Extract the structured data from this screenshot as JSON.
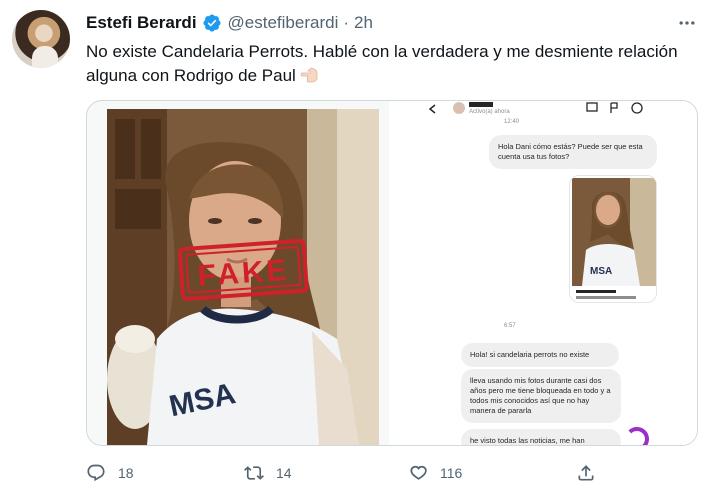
{
  "author": {
    "display_name": "Estefi Berardi",
    "handle": "@estefiberardi",
    "separator": "·",
    "timestamp": "2h",
    "verified": true
  },
  "tweet": {
    "text": "No existe Candelaria Perrots. Hablé con la verdadera y me desmiente relación alguna con Rodrigo de Paul",
    "emoji": "pointing-left-hand"
  },
  "media": {
    "left_image_stamp": "FAKE",
    "dm_screenshot": {
      "status": "Activo(a) ahora",
      "time_top": "12:40",
      "time_mid": "6:57",
      "messages": [
        "Hola Dani cómo estás? Puede ser que esta cuenta usa tus fotos?",
        "Hola! si candelaria perrots no existe",
        "lleva usando mis fotos durante casi dos años pero me tiene bloqueada en todo y a todos mis conocidos así que no hay manera de pararla",
        "he visto todas las noticias, me han"
      ]
    }
  },
  "actions": {
    "reply_count": "18",
    "retweet_count": "14",
    "like_count": "116"
  },
  "colors": {
    "text": "#0f1419",
    "secondary": "#536471",
    "verified": "#1d9bf0",
    "stamp": "#d0202a",
    "border": "#cfd9de"
  }
}
